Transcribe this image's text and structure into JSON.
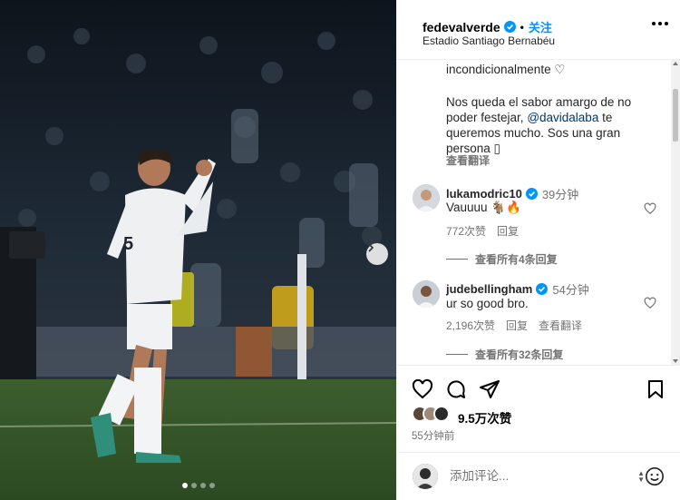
{
  "post": {
    "username": "fedevalverde",
    "follow_label": "关注",
    "separator": "•",
    "location": "Estadio Santiago Bernabéu",
    "more_icon": "more-horizontal-icon"
  },
  "caption": {
    "lines": [
      "incondicionalmente ♡",
      "Nos queda el sabor amargo de no poder festejar,",
      "te queremos mucho. Sos una gran persona ▯"
    ],
    "line1": "incondicionalmente ♡",
    "para_pre": "Nos queda el sabor amargo de no poder festejar, ",
    "mention": "@davidalaba",
    "para_post": " te queremos mucho. Sos una gran persona ▯",
    "translate_label": "查看翻译"
  },
  "comments": [
    {
      "username": "lukamodric10",
      "time": "39分钟",
      "text": "Vauuuu 🐐🔥",
      "likes": "772次赞",
      "reply_label": "回复",
      "view_replies": "查看所有4条回复"
    },
    {
      "username": "judebellingham",
      "time": "54分钟",
      "text": "ur so good bro.",
      "likes": "2,196次赞",
      "reply_label": "回复",
      "translate_label": "查看翻译",
      "view_replies": "查看所有32条回复"
    }
  ],
  "actions": {
    "likes_count": "9.5万次赞",
    "time_ago": "55分钟前"
  },
  "add_comment": {
    "placeholder": "添加评论..."
  },
  "carousel": {
    "slide_count": 4,
    "active_index": 0
  },
  "colors": {
    "link": "#0095f6",
    "mention": "#00376b",
    "muted": "#737373",
    "verified": "#0095f6"
  }
}
